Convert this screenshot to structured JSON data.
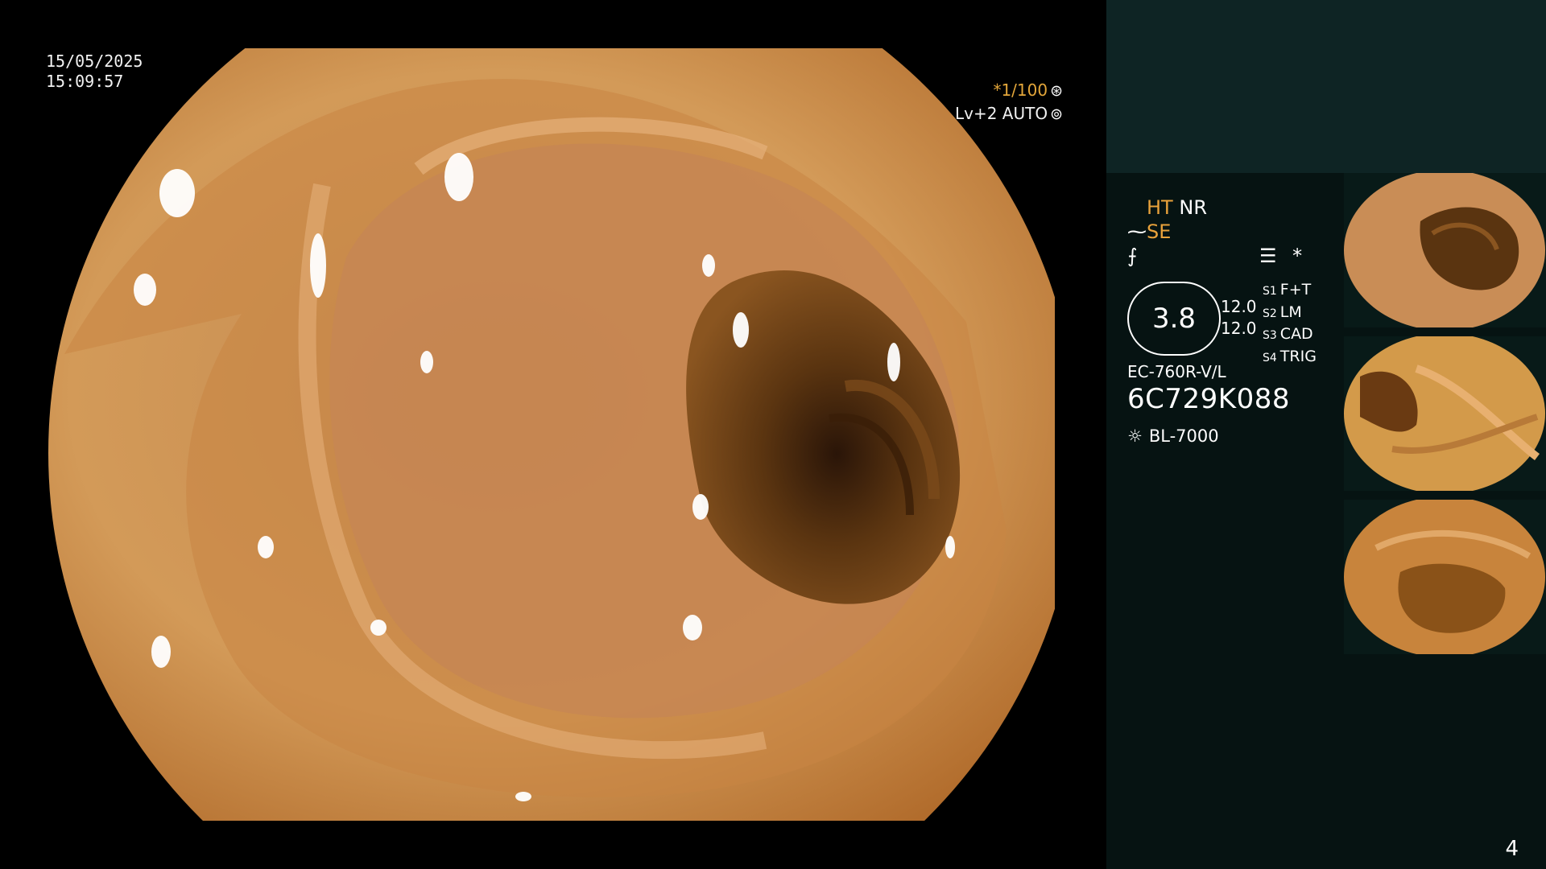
{
  "overlay": {
    "date": "15/05/2025",
    "time": "15:09:57",
    "shutter_speed": "*1/100",
    "shutter_glyph": "⊛",
    "level_mode": "Lv+2 AUTO",
    "level_glyph": "⊚"
  },
  "status_panel": {
    "ht": "HT",
    "nr": "NR",
    "se_icon": "⁓",
    "se": "SE",
    "slash_icon": "⨍",
    "menu_icon": "☰",
    "asterisk": "*",
    "gauge_value": "3.8",
    "left_value_1": "12.0",
    "left_value_2": "12.0",
    "modes": [
      {
        "key": "S1",
        "value": "F+T"
      },
      {
        "key": "S2",
        "value": "LM"
      },
      {
        "key": "S3",
        "value": "CAD"
      },
      {
        "key": "S4",
        "value": "TRIG"
      }
    ],
    "scope_model": "EC-760R-V/L",
    "serial": "6C729K088",
    "lamp_icon": "☼",
    "lamp_model": "BL-7000"
  },
  "thumbnails": [
    {
      "label": "thumbnail 1"
    },
    {
      "label": "thumbnail 2"
    },
    {
      "label": "thumbnail 3"
    }
  ],
  "page_number": "4",
  "colors": {
    "accent": "#e9a23b",
    "panel_bg": "#061312",
    "panel_top_bg": "#0e2424",
    "mucosa": "#c8843c"
  }
}
